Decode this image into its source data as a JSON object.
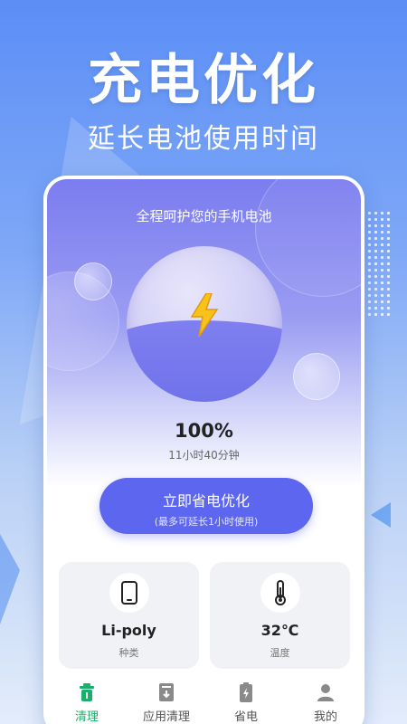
{
  "hero": {
    "title": "充电优化",
    "subtitle": "延长电池使用时间"
  },
  "screen": {
    "caption": "全程呵护您的手机电池",
    "battery_percent": "100%",
    "remaining_time": "11小时40分钟",
    "optimize_button": {
      "label": "立即省电优化",
      "sublabel": "(最多可延长1小时使用)"
    },
    "cards": [
      {
        "icon": "phone-icon",
        "value": "Li-poly",
        "label": "种类"
      },
      {
        "icon": "thermometer-icon",
        "value": "32℃",
        "label": "温度"
      }
    ],
    "tabs": [
      {
        "icon": "trash-icon",
        "label": "清理",
        "active": true
      },
      {
        "icon": "app-clean-icon",
        "label": "应用清理",
        "active": false
      },
      {
        "icon": "battery-icon",
        "label": "省电",
        "active": false
      },
      {
        "icon": "user-icon",
        "label": "我的",
        "active": false
      }
    ]
  },
  "colors": {
    "accent": "#5d66ee",
    "active_tab": "#19b06a",
    "background_top": "#5b8ef6"
  }
}
